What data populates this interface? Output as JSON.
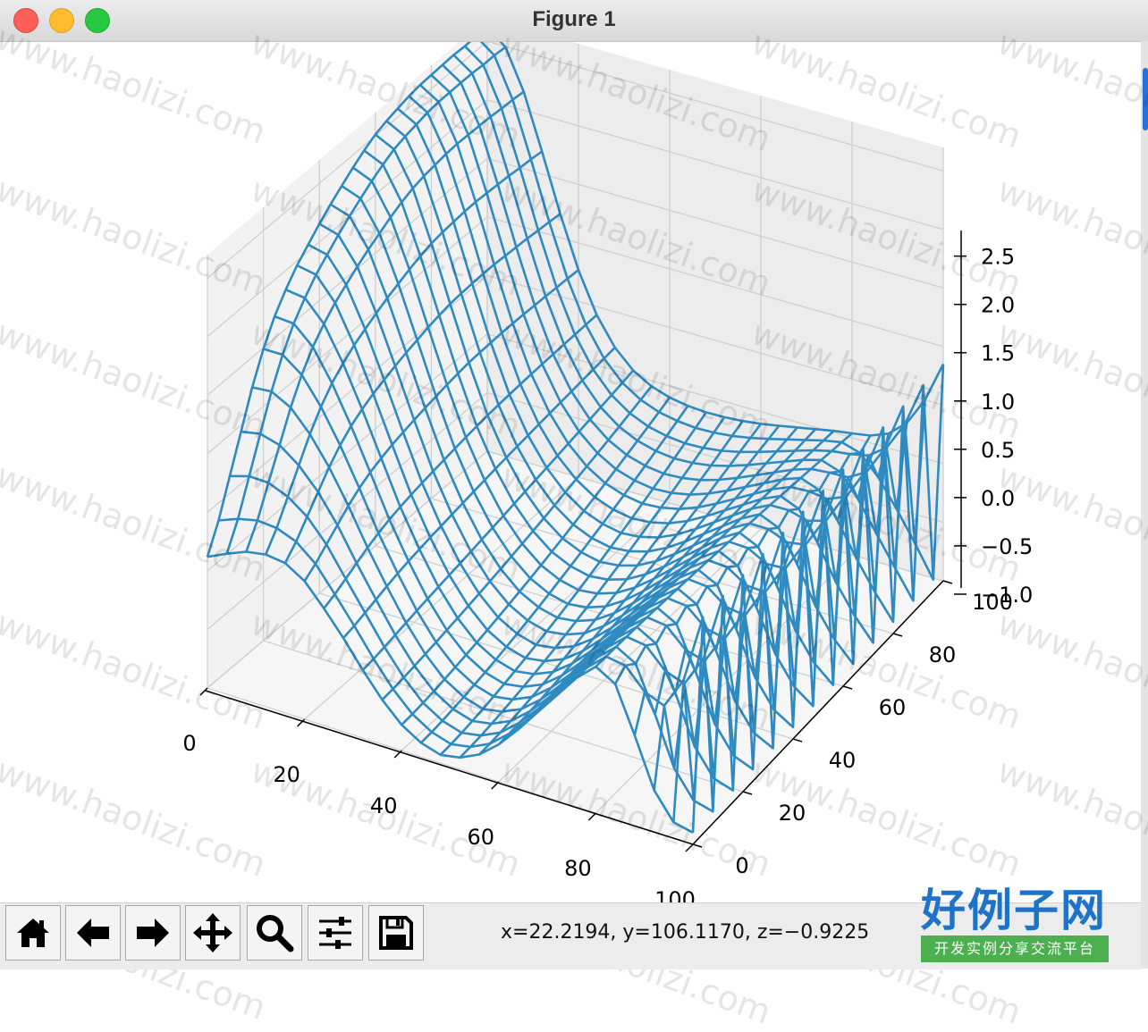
{
  "window": {
    "title": "Figure 1"
  },
  "toolbar": {
    "buttons": [
      {
        "name": "home",
        "icon": "home-icon"
      },
      {
        "name": "back",
        "icon": "arrow-left-icon"
      },
      {
        "name": "forward",
        "icon": "arrow-right-icon"
      },
      {
        "name": "pan",
        "icon": "move-icon"
      },
      {
        "name": "zoom",
        "icon": "magnifier-icon"
      },
      {
        "name": "configure-subplots",
        "icon": "sliders-icon"
      },
      {
        "name": "save",
        "icon": "floppy-disk-icon"
      }
    ],
    "coords": "x=22.2194, y=106.1170, z=−0.9225"
  },
  "watermark": {
    "text": "www.haolizi.com"
  },
  "logo": {
    "main": "好例子网",
    "sub": "开发实例分享交流平台"
  },
  "colors": {
    "surface": "#2e8ac0",
    "pane": "#f2f2f2",
    "grid": "#cfcfcf",
    "logo_blue": "#1e73c8",
    "logo_green": "#4caf50"
  },
  "chart_data": {
    "type": "surface",
    "style": "wireframe",
    "x_ticks": [
      0,
      20,
      40,
      60,
      80,
      100
    ],
    "y_ticks": [
      0,
      20,
      40,
      60,
      80,
      100
    ],
    "z_ticks": [
      "−1.0",
      "−0.5",
      "0.0",
      "0.5",
      "1.0",
      "1.5",
      "2.0",
      "2.5"
    ],
    "xlim": [
      0,
      100
    ],
    "ylim": [
      0,
      100
    ],
    "zlim": [
      -1.0,
      2.7
    ],
    "grid": true,
    "legend": "none",
    "surface_grid_x": [
      0,
      4,
      8,
      12,
      16,
      20,
      24,
      28,
      32,
      36,
      40,
      44,
      48,
      52,
      56,
      60,
      64,
      68,
      72,
      76,
      80,
      84,
      88,
      92,
      96,
      100
    ],
    "surface_grid_y": [
      0,
      4,
      8,
      12,
      16,
      20,
      24,
      28,
      32,
      36,
      40,
      44,
      48,
      52,
      56,
      60,
      64,
      68,
      72,
      76,
      80,
      84,
      88,
      92,
      96,
      100
    ],
    "z_at_x0": [
      0.12,
      0.35,
      0.65,
      0.95,
      1.25,
      1.5,
      1.7,
      1.85,
      1.98,
      2.08,
      2.18,
      2.27,
      2.35,
      2.43,
      2.5,
      2.56,
      2.6,
      2.63,
      2.66,
      2.68,
      2.69,
      2.7,
      2.71,
      2.71,
      2.72,
      2.72
    ],
    "z_at_x100": [
      -0.9,
      0.85,
      -0.9,
      0.85,
      -0.9,
      0.85,
      -0.9,
      0.85,
      -0.9,
      0.85,
      -0.9,
      0.85,
      -0.9,
      0.85,
      -0.9,
      0.85,
      -0.9,
      0.85,
      -0.9,
      0.85,
      -0.9,
      0.85,
      -0.9,
      0.85,
      -0.9,
      0.85
    ],
    "z_at_y0": [
      0.12,
      0.2,
      0.27,
      0.3,
      0.28,
      0.18,
      0.0,
      -0.2,
      -0.42,
      -0.62,
      -0.78,
      -0.88,
      -0.93,
      -0.9,
      -0.82,
      -0.68,
      -0.5,
      -0.3,
      -0.1,
      0.1,
      0.25,
      0.2,
      -0.1,
      -0.5,
      -0.8,
      -0.9
    ]
  }
}
